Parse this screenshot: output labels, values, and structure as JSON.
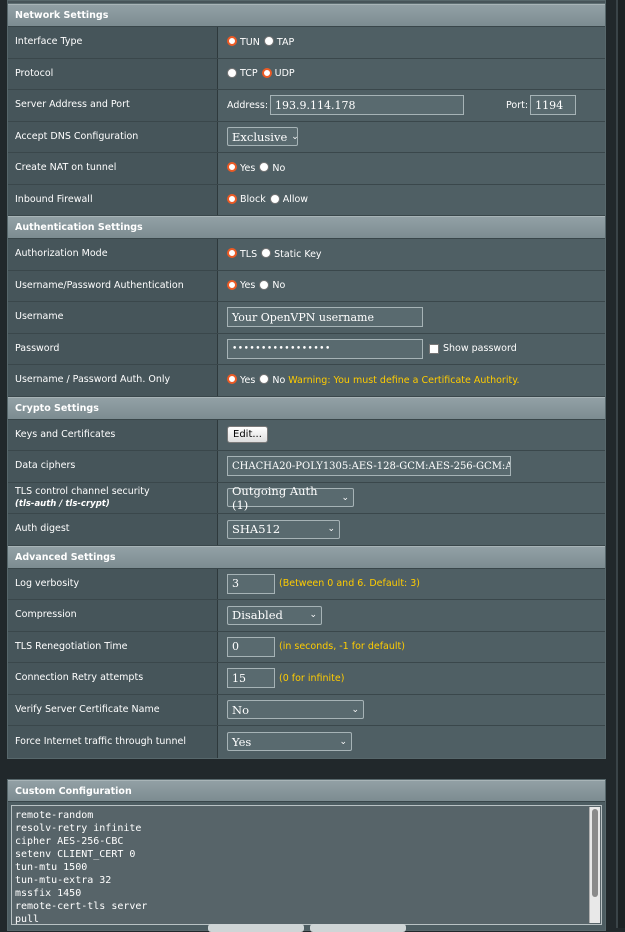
{
  "sections": {
    "network": "Network Settings",
    "auth": "Authentication Settings",
    "crypto": "Crypto Settings",
    "advanced": "Advanced Settings",
    "custom": "Custom Configuration"
  },
  "network": {
    "interface_type": {
      "label": "Interface Type",
      "opt1": "TUN",
      "opt2": "TAP",
      "selected": "TUN"
    },
    "protocol": {
      "label": "Protocol",
      "opt1": "TCP",
      "opt2": "UDP",
      "selected": "UDP"
    },
    "server": {
      "label": "Server Address and Port",
      "address_label": "Address:",
      "address_value": "193.9.114.178",
      "port_label": "Port:",
      "port_value": "1194"
    },
    "dns": {
      "label": "Accept DNS Configuration",
      "value": "Exclusive"
    },
    "nat": {
      "label": "Create NAT on tunnel",
      "opt1": "Yes",
      "opt2": "No",
      "selected": "Yes"
    },
    "firewall": {
      "label": "Inbound Firewall",
      "opt1": "Block",
      "opt2": "Allow",
      "selected": "Block"
    }
  },
  "auth": {
    "mode": {
      "label": "Authorization Mode",
      "opt1": "TLS",
      "opt2": "Static Key",
      "selected": "TLS"
    },
    "userpass": {
      "label": "Username/Password Authentication",
      "opt1": "Yes",
      "opt2": "No",
      "selected": "Yes"
    },
    "username": {
      "label": "Username",
      "value": "Your OpenVPN username"
    },
    "password": {
      "label": "Password",
      "value": "•••••••••••••••••",
      "show_label": "Show password"
    },
    "only": {
      "label": "Username / Password Auth. Only",
      "opt1": "Yes",
      "opt2": "No",
      "selected": "Yes",
      "warning": "Warning: You must define a Certificate Authority."
    }
  },
  "crypto": {
    "keys": {
      "label": "Keys and Certificates",
      "button": "Edit..."
    },
    "ciphers": {
      "label": "Data ciphers",
      "value": "CHACHA20-POLY1305:AES-128-GCM:AES-256-GCM:AE"
    },
    "tls": {
      "label": "TLS control channel security",
      "sublabel": "(tls-auth / tls-crypt)",
      "value": "Outgoing Auth (1)"
    },
    "digest": {
      "label": "Auth digest",
      "value": "SHA512"
    }
  },
  "advanced": {
    "verbosity": {
      "label": "Log verbosity",
      "value": "3",
      "hint": "(Between 0 and 6. Default: 3)"
    },
    "compression": {
      "label": "Compression",
      "value": "Disabled"
    },
    "reneg": {
      "label": "TLS Renegotiation Time",
      "value": "0",
      "hint": "(in seconds, -1 for default)"
    },
    "retry": {
      "label": "Connection Retry attempts",
      "value": "15",
      "hint": "(0 for infinite)"
    },
    "verify": {
      "label": "Verify Server Certificate Name",
      "value": "No"
    },
    "force": {
      "label": "Force Internet traffic through tunnel",
      "value": "Yes"
    }
  },
  "custom_lines": [
    "remote-random",
    "resolv-retry infinite",
    "cipher AES-256-CBC",
    "setenv CLIENT_CERT 0",
    "tun-mtu 1500",
    "tun-mtu-extra 32",
    "mssfix 1450",
    "remote-cert-tls server",
    "pull"
  ],
  "colors": {
    "radio_checked": "#ec5a24",
    "hint": "#ffcc00",
    "header": "#8797a0"
  }
}
